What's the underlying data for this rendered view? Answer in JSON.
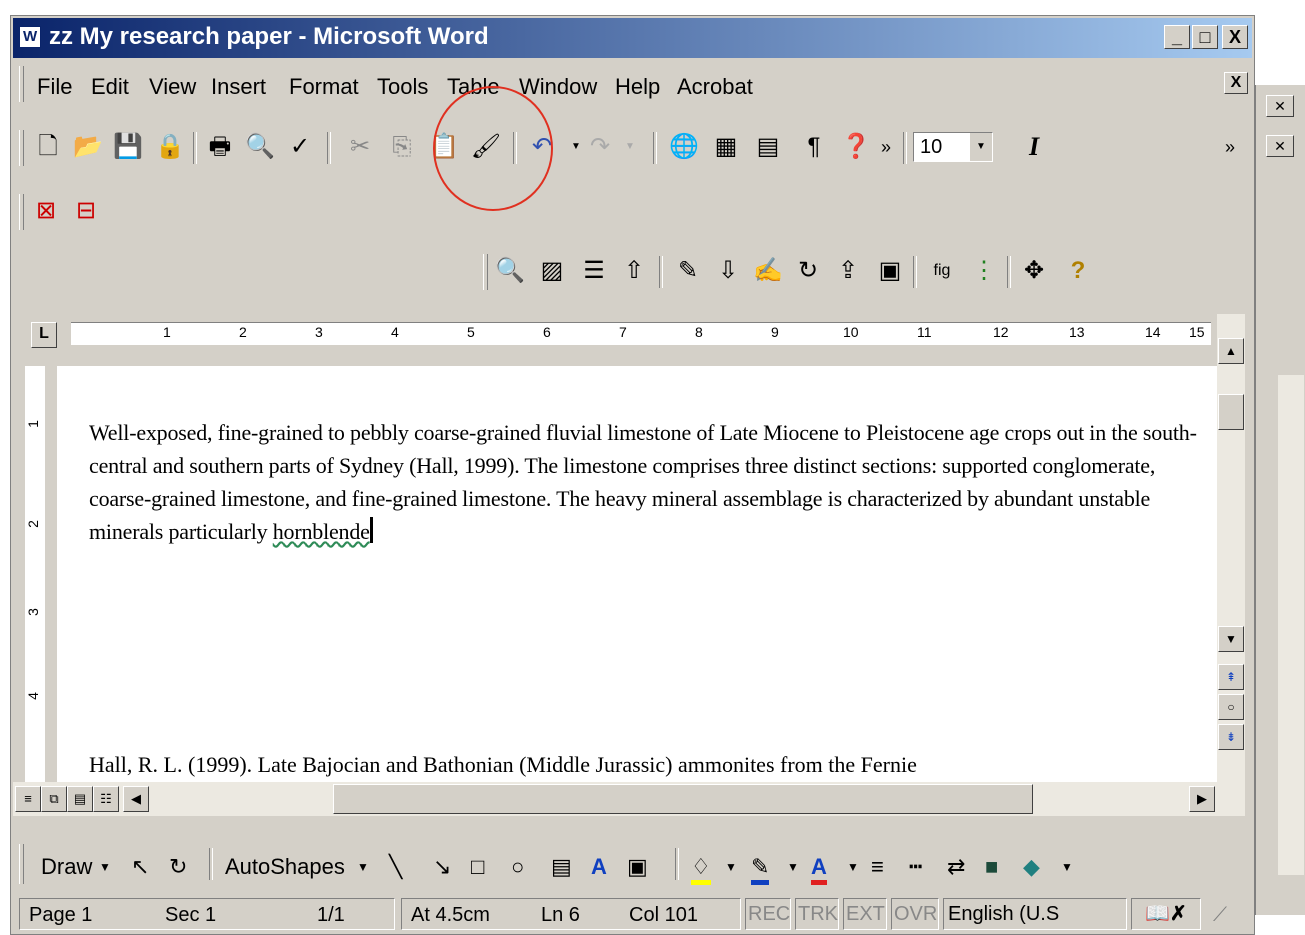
{
  "window": {
    "title": "zz My research paper - Microsoft Word"
  },
  "caption_buttons": {
    "minimize": "_",
    "maximize": "□",
    "close": "X"
  },
  "menu": {
    "items": [
      "File",
      "Edit",
      "View",
      "Insert",
      "Format",
      "Tools",
      "Table",
      "Window",
      "Help",
      "Acrobat"
    ],
    "close_doc": "X"
  },
  "toolbar": {
    "standard_icons": [
      "new-icon",
      "open-icon",
      "save-icon",
      "permission-icon",
      "print-icon",
      "print-preview-icon",
      "spelling-icon",
      "cut-icon",
      "copy-icon",
      "paste-icon",
      "format-painter-icon",
      "undo-icon",
      "redo-icon",
      "hyperlink-icon",
      "tables-borders-icon",
      "insert-table-icon",
      "show-formatting-icon",
      "help-icon"
    ],
    "font_size": "10",
    "italic_label": "I",
    "overflow": "»"
  },
  "pdf_toolbar": {
    "icons": [
      "convert-to-pdf-icon",
      "convert-and-email-icon"
    ]
  },
  "reference_toolbar": {
    "icons": [
      "magnify-icon",
      "insert-image-icon",
      "bullet-list-icon",
      "insert-citation-icon",
      "edit-icon",
      "download-icon",
      "sign-icon",
      "redo-icon",
      "export-icon",
      "notes-icon",
      "figure-icon",
      "numbered-list-icon",
      "format-icon",
      "help-icon"
    ]
  },
  "ruler": {
    "tab_selector": "L",
    "numbers": [
      "1",
      "2",
      "3",
      "4",
      "5",
      "6",
      "7",
      "8",
      "9",
      "10",
      "11",
      "12",
      "13",
      "14",
      "15"
    ]
  },
  "vruler": {
    "numbers": [
      "1",
      "2",
      "3",
      "4"
    ]
  },
  "document": {
    "paragraph_main": "Well-exposed, fine-grained to pebbly coarse-grained fluvial limestone of Late Miocene to Pleistocene age crops out in the south-central and southern parts of Sydney (Hall, 1999). The limestone comprises three distinct sections: supported conglomerate, coarse-grained limestone, and fine-grained limestone. The heavy mineral assemblage is characterized by abundant unstable minerals particularly ",
    "paragraph_last_word": "hornblende",
    "reference": "Hall, R. L. (1999). Late Bajocian and Bathonian (Middle Jurassic) ammonites from the Fernie"
  },
  "draw_toolbar": {
    "draw_label": "Draw",
    "autoshapes_label": "AutoShapes"
  },
  "status": {
    "page": "Page 1",
    "sec": "Sec 1",
    "pages": "1/1",
    "at": "At 4.5cm",
    "ln": "Ln 6",
    "col": "Col 101",
    "rec": "REC",
    "trk": "TRK",
    "ext": "EXT",
    "ovr": "OVR",
    "language": "English (U.S"
  },
  "colors": {
    "title_start": "#0a246a",
    "title_end": "#a6caf0",
    "chrome": "#d4d0c8",
    "annotation": "#e03020"
  }
}
